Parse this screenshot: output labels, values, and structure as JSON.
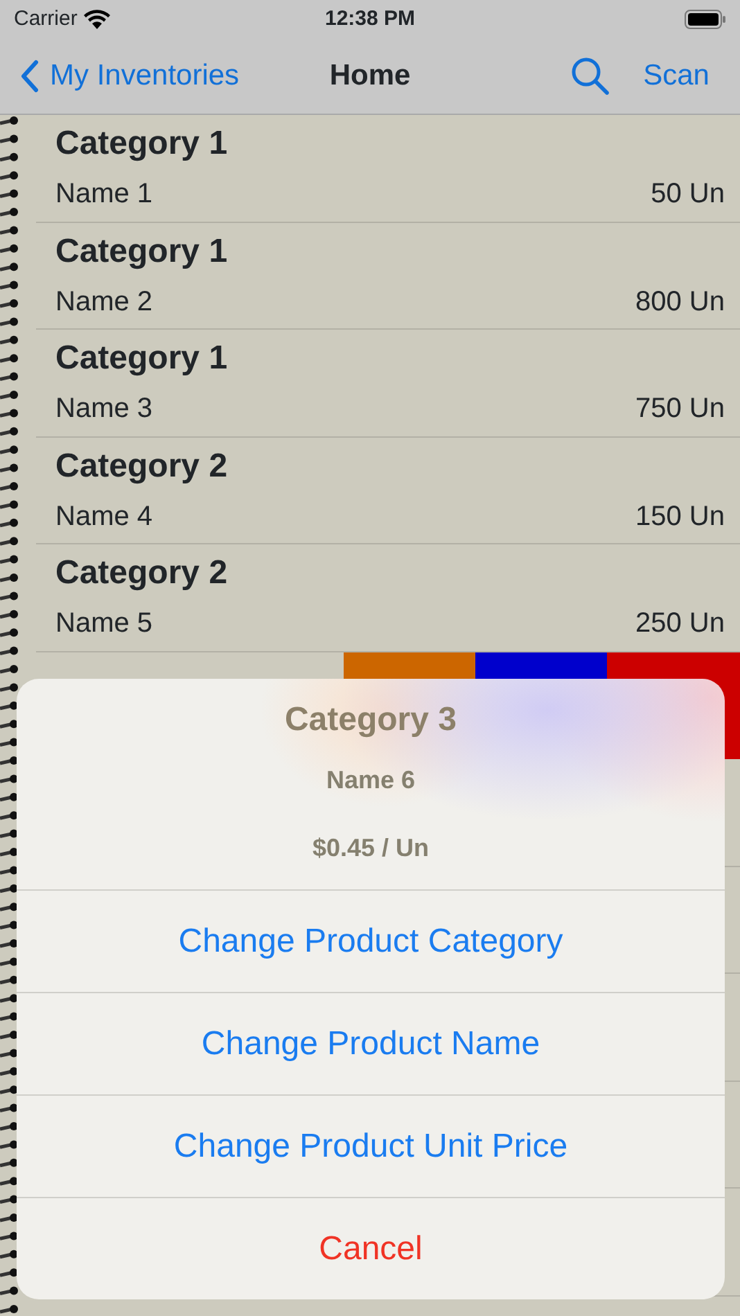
{
  "status_bar": {
    "carrier": "Carrier",
    "time": "12:38 PM"
  },
  "nav": {
    "back": "My Inventories",
    "title": "Home",
    "action": "Scan"
  },
  "items": [
    {
      "category": "Category 1",
      "name": "Name 1",
      "quantity": "50 Un"
    },
    {
      "category": "Category 1",
      "name": "Name 2",
      "quantity": "800 Un"
    },
    {
      "category": "Category 1",
      "name": "Name 3",
      "quantity": "750 Un"
    },
    {
      "category": "Category 2",
      "name": "Name 4",
      "quantity": "150 Un"
    },
    {
      "category": "Category 2",
      "name": "Name 5",
      "quantity": "250 Un"
    }
  ],
  "color_tags": [
    {
      "color": "#cc6600"
    },
    {
      "color": "#0000cc"
    },
    {
      "color": "#cc0000"
    }
  ],
  "action_sheet": {
    "title": "Category 3",
    "subtitle": "Name 6",
    "price": "$0.45 / Un",
    "actions": [
      {
        "label": "Change Product Category",
        "kind": "default"
      },
      {
        "label": "Change Product Name",
        "kind": "default"
      },
      {
        "label": "Change Product Unit Price",
        "kind": "default"
      },
      {
        "label": "Cancel",
        "kind": "destructive"
      }
    ]
  }
}
